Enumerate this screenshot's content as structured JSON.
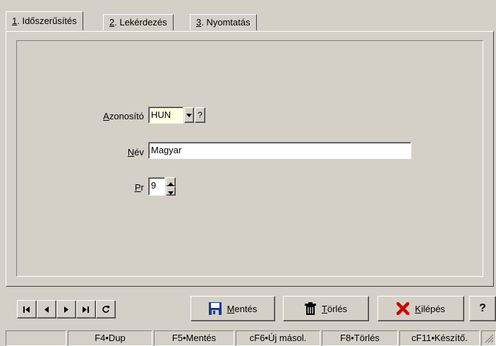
{
  "tabs": [
    {
      "key": "1",
      "label": ". Időszerűsítés"
    },
    {
      "key": "2",
      "label": ". Lekérdezés"
    },
    {
      "key": "3",
      "label": ". Nyomtatás"
    }
  ],
  "form": {
    "azonosito_key": "A",
    "azonosito_rest": "zonosító",
    "azonosito_value": "HUN",
    "lookup_label": "?",
    "nev_key": "N",
    "nev_rest": "év",
    "nev_value": "Magyar",
    "pr_key": "P",
    "pr_rest": "r",
    "pr_value": "9"
  },
  "buttons": {
    "mentes_key": "M",
    "mentes_rest": "entés",
    "torles_key": "T",
    "torles_rest": "örlés",
    "kilepes_key": "K",
    "kilepes_rest": "ilépés",
    "help": "?"
  },
  "status": [
    "",
    "F4•Dup",
    "F5•Mentés",
    "cF6•Új másol.",
    "F8•Törlés",
    "cF11•Készítő."
  ],
  "icons": {
    "first": "first-record-icon",
    "prev": "previous-record-icon",
    "next": "next-record-icon",
    "last": "last-record-icon",
    "refresh": "refresh-icon",
    "save": "floppy-disk-icon",
    "delete": "trash-can-icon",
    "exit": "red-x-icon"
  },
  "colors": {
    "face": "#d4d0c8",
    "exit_x": "#cc0000",
    "save_blue": "#1a3a8f",
    "field_yellow": "#ffffe1"
  }
}
